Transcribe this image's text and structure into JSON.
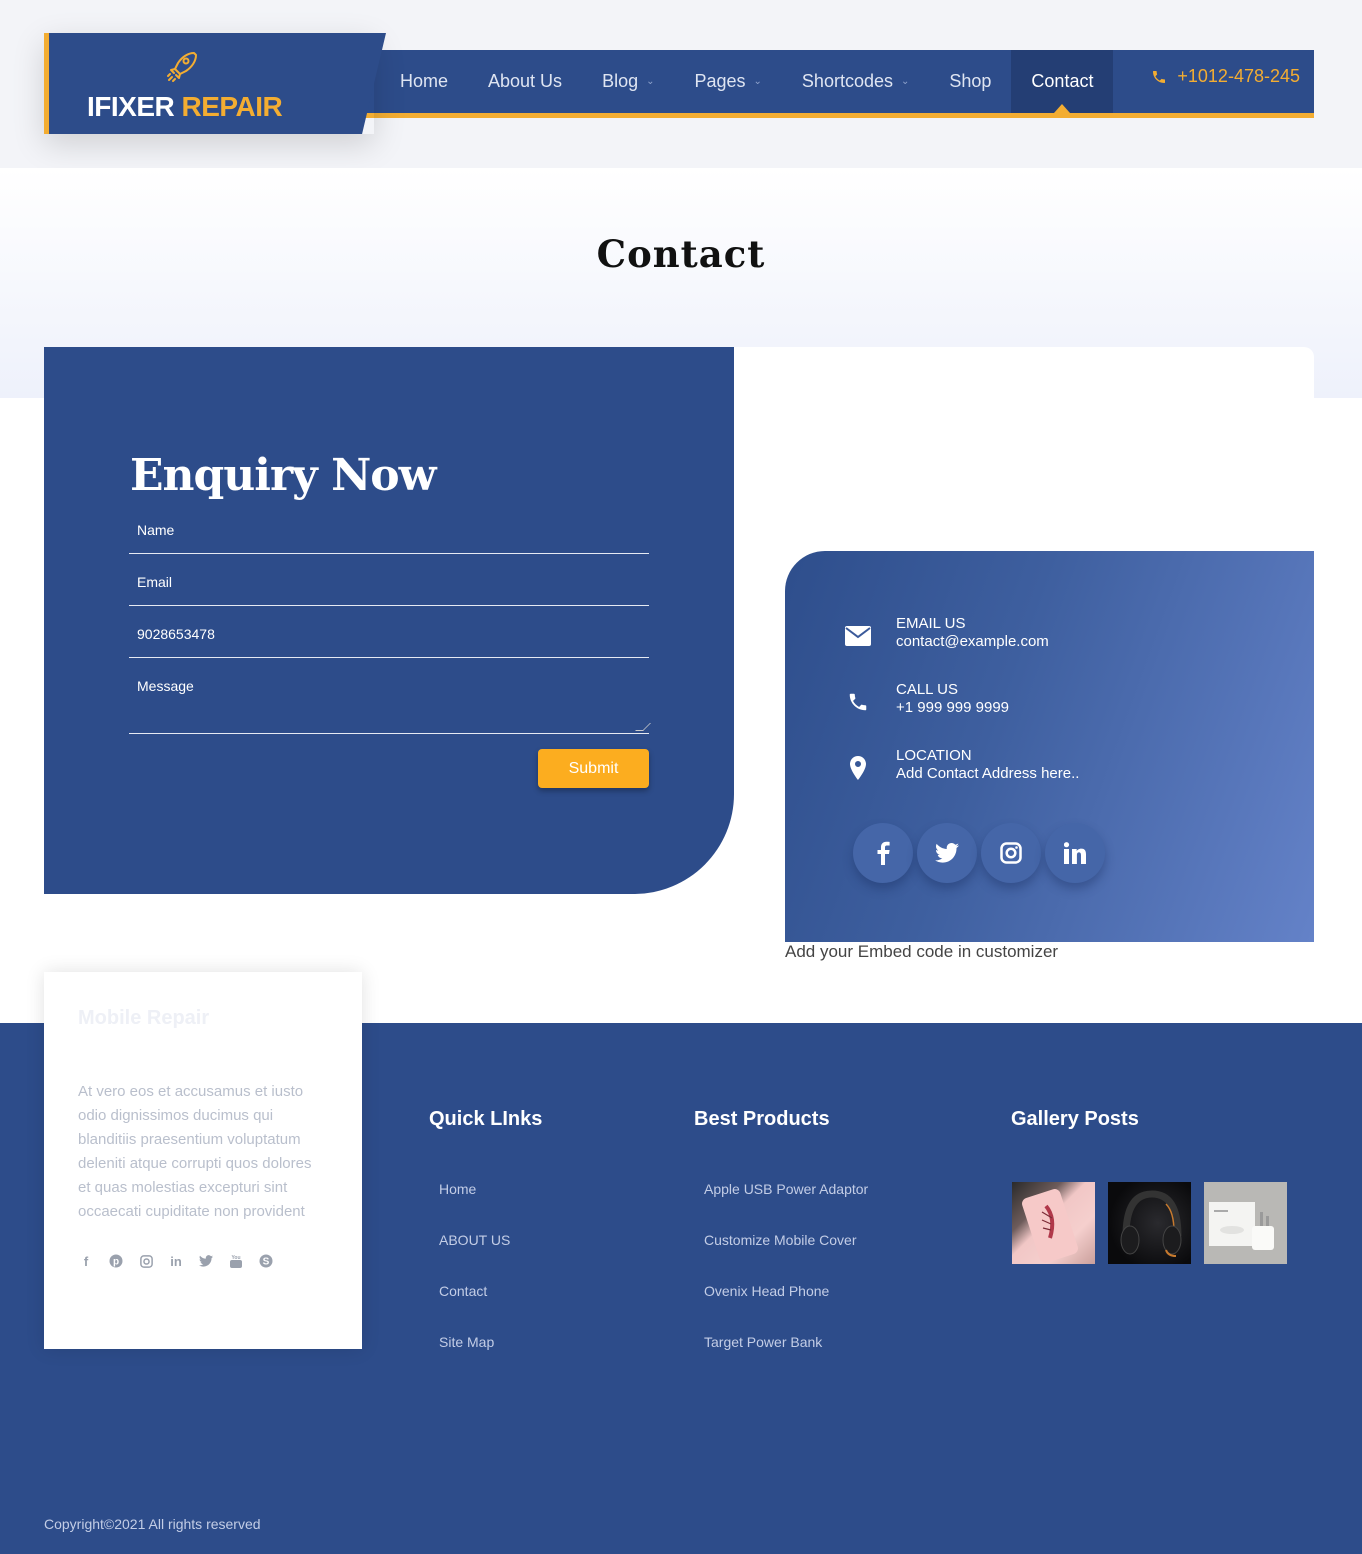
{
  "header": {
    "logo": {
      "part1": "IFIXER",
      "part2": "REPAIR",
      "icon": "rocket-icon"
    },
    "nav": [
      {
        "label": "Home",
        "dropdown": false
      },
      {
        "label": "About Us",
        "dropdown": false
      },
      {
        "label": "Blog",
        "dropdown": true
      },
      {
        "label": "Pages",
        "dropdown": true
      },
      {
        "label": "Shortcodes",
        "dropdown": true
      },
      {
        "label": "Shop",
        "dropdown": false
      },
      {
        "label": "Contact",
        "dropdown": false,
        "active": true
      }
    ],
    "phone": "+1012-478-245",
    "phone_icon": "phone-icon"
  },
  "page": {
    "title": "Contact"
  },
  "enquiry": {
    "title": "Enquiry Now",
    "fields": {
      "name_placeholder": "Name",
      "email_placeholder": "Email",
      "phone_value": "9028653478",
      "message_placeholder": "Message"
    },
    "submit_label": "Submit"
  },
  "contact_info": {
    "items": [
      {
        "icon": "envelope-icon",
        "label": "EMAIL US",
        "value": "contact@example.com"
      },
      {
        "icon": "phone-icon",
        "label": "CALL US",
        "value": "+1 999 999 9999"
      },
      {
        "icon": "map-pin-icon",
        "label": "LOCATION",
        "value": "Add Contact Address here.."
      }
    ],
    "socials": [
      "facebook-icon",
      "twitter-icon",
      "instagram-icon",
      "linkedin-icon"
    ],
    "embed_note": "Add your Embed code in customizer"
  },
  "footer": {
    "about": {
      "title": "Mobile Repair",
      "text": "At vero eos et accusamus et iusto odio dignissimos ducimus qui blanditiis praesentium voluptatum deleniti atque corrupti quos dolores et quas molestias excepturi sint occaecati cupiditate non provident",
      "socials": [
        "facebook-icon",
        "pinterest-icon",
        "instagram-icon",
        "linkedin-icon",
        "twitter-icon",
        "youtube-icon",
        "skype-icon"
      ]
    },
    "quick_links": {
      "title": "Quick LInks",
      "items": [
        "Home",
        "ABOUT US",
        "Contact",
        "Site Map"
      ]
    },
    "best_products": {
      "title": "Best Products",
      "items": [
        "Apple USB Power Adaptor",
        "Customize Mobile Cover",
        "Ovenix Head Phone",
        "Target Power Bank"
      ]
    },
    "gallery": {
      "title": "Gallery Posts",
      "items": [
        "phone-case-image",
        "headphones-image",
        "power-adaptor-image"
      ]
    },
    "copyright": "Copyright©2021 All rights reserved"
  },
  "colors": {
    "primary": "#2d4c8a",
    "accent": "#f3ad32",
    "button": "#fcad1f"
  }
}
